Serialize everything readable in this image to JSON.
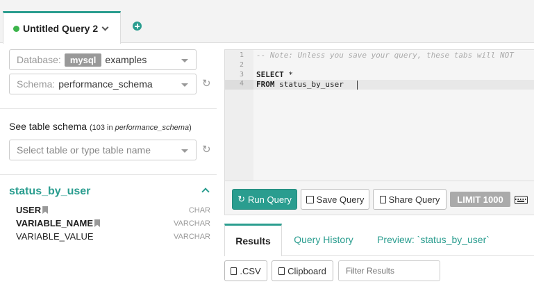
{
  "tabs": {
    "active_label": "Untitled Query 2"
  },
  "left": {
    "database": {
      "label": "Database:",
      "badge": "mysql",
      "value": "examples"
    },
    "schema": {
      "label": "Schema:",
      "value": "performance_schema"
    },
    "see_schema": {
      "title": "See table schema",
      "count_prefix": "(103 in ",
      "count_schema": "performance_schema",
      "count_suffix": ")"
    },
    "table_select": {
      "placeholder": "Select table or type table name"
    },
    "table": {
      "name": "status_by_user",
      "columns": [
        {
          "name": "USER",
          "type": "CHAR"
        },
        {
          "name": "VARIABLE_NAME",
          "type": "VARCHAR"
        },
        {
          "name": "VARIABLE_VALUE",
          "type": "VARCHAR"
        }
      ]
    }
  },
  "editor": {
    "line_numbers": [
      "1",
      "2",
      "3",
      "4"
    ],
    "line1": "-- Note: Unless you save your query, these tabs will NOT",
    "line3_kw": "SELECT",
    "line3_rest": " *",
    "line4_kw": "FROM",
    "line4_rest": " status_by_user"
  },
  "toolbar": {
    "run": "Run Query",
    "save": "Save Query",
    "share": "Share Query",
    "limit": "LIMIT 1000"
  },
  "results": {
    "tabs": [
      "Results",
      "Query History",
      "Preview: `status_by_user`"
    ],
    "csv": ".CSV",
    "clipboard": "Clipboard",
    "filter_placeholder": "Filter Results"
  },
  "colors": {
    "accent": "#2a9d8f",
    "status_green": "#3cb44b"
  }
}
